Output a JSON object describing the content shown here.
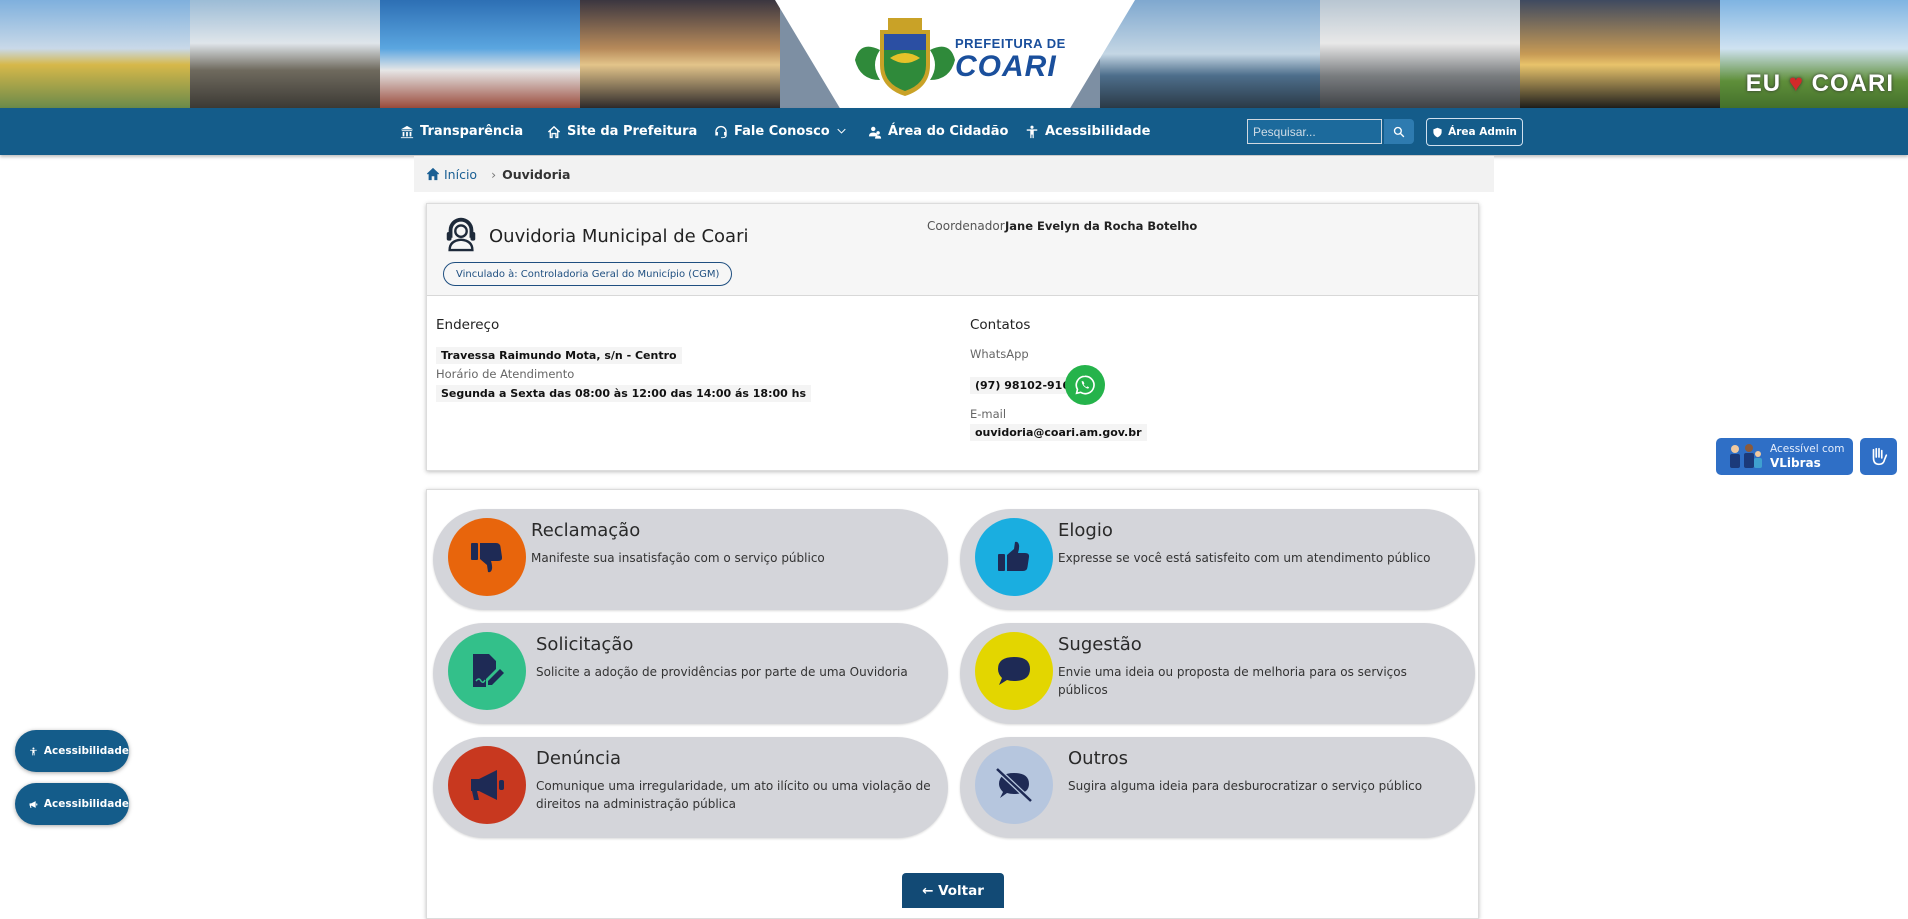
{
  "header": {
    "logo_top": "PREFEITURA DE",
    "logo_main": "COARI",
    "eu_left": "EU",
    "eu_right": "COARI"
  },
  "nav": {
    "items": [
      {
        "label": "Transparência",
        "icon": "bank-icon"
      },
      {
        "label": "Site da Prefeitura",
        "icon": "home-icon"
      },
      {
        "label": "Fale Conosco",
        "icon": "headset-icon"
      },
      {
        "label": "Área do Cidadão",
        "icon": "people-icon"
      },
      {
        "label": "Acessibilidade",
        "icon": "accessibility-icon"
      }
    ],
    "search_placeholder": "Pesquisar...",
    "admin_label": "Área Admin"
  },
  "breadcrumb": {
    "home": "Início",
    "separator": "›",
    "current": "Ouvidoria"
  },
  "info": {
    "title": "Ouvidoria Municipal de Coari",
    "vinculo": "Vinculado à: Controladoria Geral do Município (CGM)",
    "coord_label": "Coordenador",
    "coord_name": "Jane Evelyn da Rocha Botelho",
    "endereco_title": "Endereço",
    "endereco": "Travessa Raimundo Mota, s/n - Centro",
    "horario_label": "Horário de Atendimento",
    "horario": "Segunda a Sexta das 08:00 às 12:00 das 14:00 ás 18:00 hs",
    "contatos_title": "Contatos",
    "whatsapp_label": "WhatsApp",
    "whatsapp": "(97) 98102-9163",
    "email_label": "E-mail",
    "email": "ouvidoria@coari.am.gov.br"
  },
  "services": [
    {
      "title": "Reclamação",
      "desc": "Manifeste sua insatisfação com o serviço público",
      "color": "#e8650c",
      "icon": "thumbs-down-icon"
    },
    {
      "title": "Elogio",
      "desc": "Expresse se você está satisfeito com um atendimento público",
      "color": "#1aaee0",
      "icon": "thumbs-up-icon"
    },
    {
      "title": "Solicitação",
      "desc": "Solicite a adoção de providências por parte de uma Ouvidoria",
      "color": "#33c08a",
      "icon": "file-signature-icon"
    },
    {
      "title": "Sugestão",
      "desc": "Envie uma ideia ou proposta de melhoria para os serviços públicos",
      "color": "#e3d600",
      "icon": "comment-icon"
    },
    {
      "title": "Denúncia",
      "desc": "Comunique uma irregularidade, um ato ilícito ou uma violação de direitos na administração pública",
      "color": "#c8381f",
      "icon": "megaphone-icon"
    },
    {
      "title": "Outros",
      "desc": "Sugira alguma ideia para desburocratizar o serviço público",
      "color": "#b6c6de",
      "icon": "comment-slash-icon"
    }
  ],
  "voltar": "← Voltar",
  "widgets": {
    "vlibras_line1": "Acessível com",
    "vlibras_line2": "VLibras",
    "acc1": "Acessibilidade",
    "acc2": "Acessibilidade"
  },
  "colors": {
    "primary": "#145c8a",
    "whatsapp": "#25b34b",
    "vlibras": "#2f6fc6"
  }
}
